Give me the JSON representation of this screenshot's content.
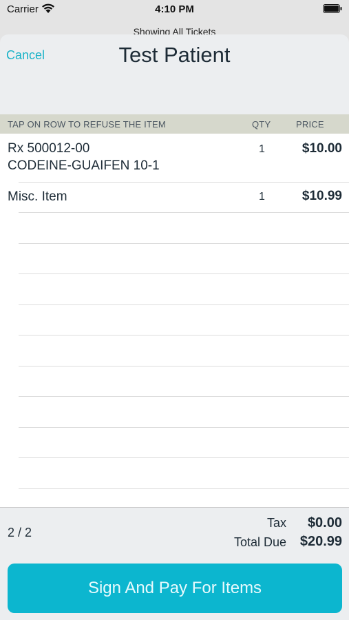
{
  "status_bar": {
    "carrier": "Carrier",
    "time": "4:10 PM",
    "icons": [
      "wifi-icon",
      "battery-icon"
    ]
  },
  "background_title": "Showing All Tickets",
  "sheet": {
    "cancel_label": "Cancel",
    "title": "Test Patient"
  },
  "table": {
    "headers": {
      "description": "TAP ON ROW TO REFUSE THE ITEM",
      "qty": "QTY",
      "price": "PRICE"
    },
    "rows": [
      {
        "line1": "Rx 500012-00",
        "line2": "CODEINE-GUAIFEN 10-1",
        "qty": "1",
        "price": "$10.00"
      },
      {
        "line1": "Misc. Item",
        "qty": "1",
        "price": "$10.99"
      }
    ]
  },
  "footer": {
    "pager": "2 / 2",
    "tax_label": "Tax",
    "tax_value": "$0.00",
    "total_label": "Total Due",
    "total_value": "$20.99",
    "pay_button_label": "Sign And Pay For Items"
  },
  "colors": {
    "accent": "#0cb6cf",
    "link": "#1bb3c8",
    "header_band": "#d6d8cc"
  }
}
